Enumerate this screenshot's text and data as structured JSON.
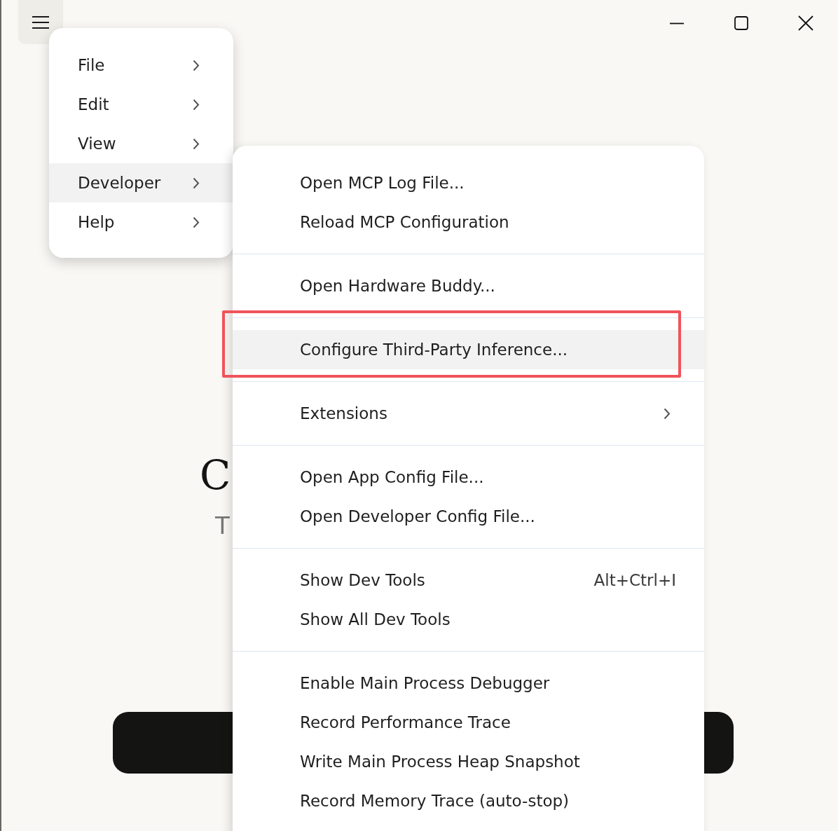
{
  "background": {
    "heading": "C",
    "subtitle": "T"
  },
  "menu": {
    "items": [
      {
        "label": "File",
        "has_submenu": true,
        "selected": false
      },
      {
        "label": "Edit",
        "has_submenu": true,
        "selected": false
      },
      {
        "label": "View",
        "has_submenu": true,
        "selected": false
      },
      {
        "label": "Developer",
        "has_submenu": true,
        "selected": true
      },
      {
        "label": "Help",
        "has_submenu": true,
        "selected": false
      }
    ]
  },
  "submenu": {
    "groups": [
      {
        "items": [
          {
            "label": "Open MCP Log File...",
            "has_submenu": false,
            "selected": false,
            "outlined": false
          },
          {
            "label": "Reload MCP Configuration",
            "has_submenu": false,
            "selected": false,
            "outlined": false
          }
        ]
      },
      {
        "items": [
          {
            "label": "Open Hardware Buddy...",
            "has_submenu": false,
            "selected": false,
            "outlined": false
          }
        ]
      },
      {
        "items": [
          {
            "label": "Configure Third-Party Inference...",
            "has_submenu": false,
            "selected": true,
            "outlined": true
          }
        ]
      },
      {
        "items": [
          {
            "label": "Extensions",
            "has_submenu": true,
            "selected": false,
            "outlined": false
          }
        ]
      },
      {
        "items": [
          {
            "label": "Open App Config File...",
            "has_submenu": false,
            "selected": false,
            "outlined": false
          },
          {
            "label": "Open Developer Config File...",
            "has_submenu": false,
            "selected": false,
            "outlined": false
          }
        ]
      },
      {
        "items": [
          {
            "label": "Show Dev Tools",
            "shortcut": "Alt+Ctrl+I",
            "has_submenu": false,
            "selected": false,
            "outlined": false
          },
          {
            "label": "Show All Dev Tools",
            "has_submenu": false,
            "selected": false,
            "outlined": false
          }
        ]
      },
      {
        "items": [
          {
            "label": "Enable Main Process Debugger",
            "has_submenu": false,
            "selected": false,
            "outlined": false
          },
          {
            "label": "Record Performance Trace",
            "has_submenu": false,
            "selected": false,
            "outlined": false
          },
          {
            "label": "Write Main Process Heap Snapshot",
            "has_submenu": false,
            "selected": false,
            "outlined": false
          },
          {
            "label": "Record Memory Trace (auto-stop)",
            "has_submenu": false,
            "selected": false,
            "outlined": false
          }
        ]
      }
    ]
  }
}
